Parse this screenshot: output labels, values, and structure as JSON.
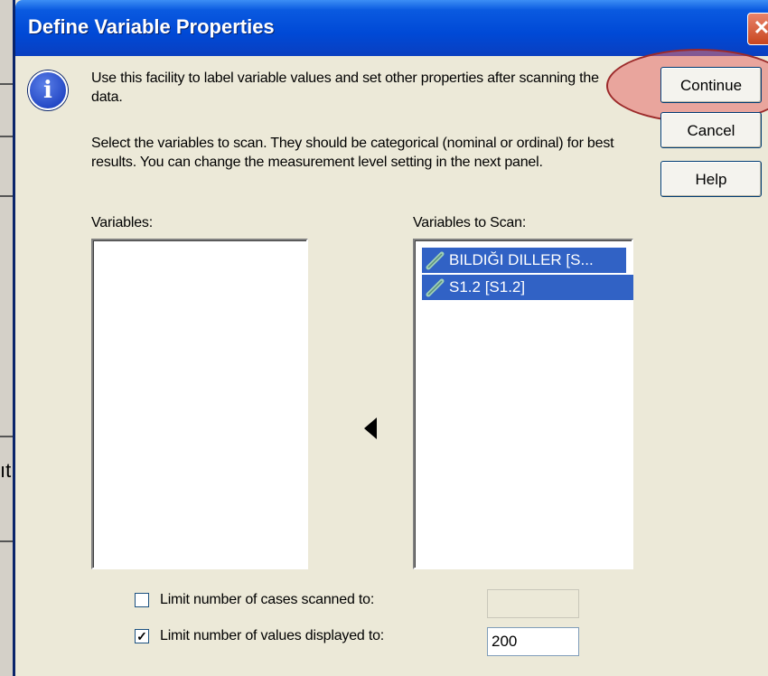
{
  "window": {
    "title": "Define Variable Properties",
    "close_glyph": "✕"
  },
  "background_app": {
    "fragment": "ıt"
  },
  "info": {
    "icon_glyph": "i",
    "paragraph1": "Use this facility to label variable values and set other properties after scanning the data.",
    "paragraph2": "Select the variables to scan.  They should be categorical (nominal or ordinal) for best results.  You can change the  measurement level setting in the next panel."
  },
  "buttons": {
    "continue": "Continue",
    "cancel": "Cancel",
    "help": "Help"
  },
  "variables": {
    "label": "Variables:",
    "items": []
  },
  "move_arrow": "◄",
  "scan": {
    "label": "Variables to Scan:",
    "items": [
      {
        "label": "BILDIĞI DILLER [S...",
        "icon": "scale-pencil-icon",
        "selected": true
      },
      {
        "label": "S1.2 [S1.2]",
        "icon": "scale-pencil-icon",
        "selected": true
      }
    ]
  },
  "options": {
    "limit_cases": {
      "label": "Limit number of cases scanned to:",
      "checked": false,
      "value": ""
    },
    "limit_values": {
      "label": "Limit number of values displayed to:",
      "checked": true,
      "value": "200",
      "check_glyph": "✓"
    }
  },
  "colors": {
    "titlebar": "#0049d6",
    "selection": "#3162c5",
    "highlight": "#e86e6e"
  }
}
